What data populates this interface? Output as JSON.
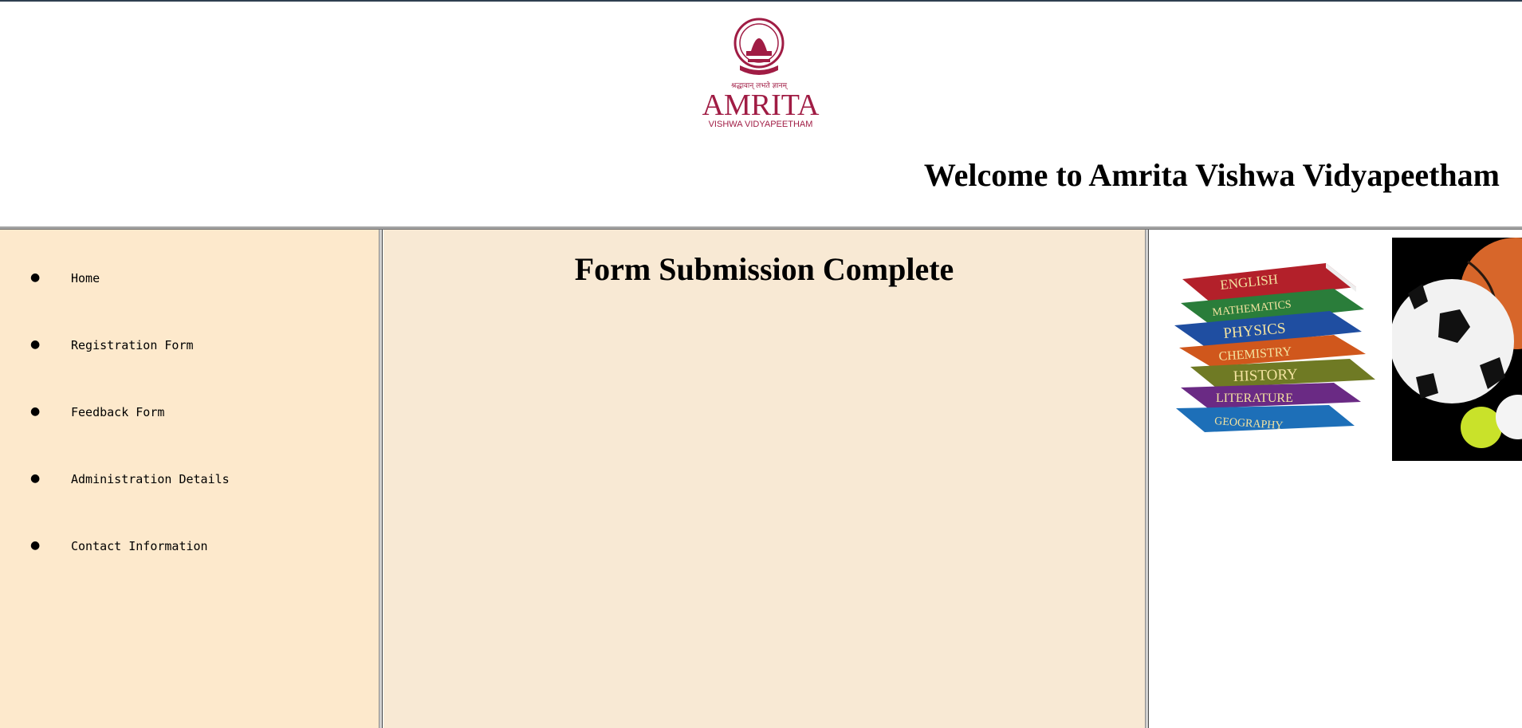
{
  "header": {
    "logo": {
      "name": "AMRITA",
      "subname": "VISHWA VIDYAPEETHAM",
      "motto": "श्रद्धावान् लभते ज्ञानम्",
      "color": "#a01c44"
    },
    "welcome_text": "Welcome to Amrita Vishwa Vidyapeetham"
  },
  "sidebar": {
    "background": "#fde9cc",
    "items": [
      {
        "label": "Home"
      },
      {
        "label": "Registration Form"
      },
      {
        "label": "Feedback Form"
      },
      {
        "label": "Administration Details"
      },
      {
        "label": "Contact Information"
      }
    ]
  },
  "main": {
    "background": "#f8e9d4",
    "title": "Form Submission Complete"
  },
  "right_panel": {
    "books_image": {
      "icon": "books-stack-image",
      "subjects": [
        "ENGLISH",
        "MATHEMATICS",
        "PHYSICS",
        "CHEMISTRY",
        "HISTORY",
        "LITERATURE",
        "GEOGRAPHY"
      ],
      "colors": [
        "#b3202a",
        "#2a7d3a",
        "#1f4ea1",
        "#d0571c",
        "#6f7a24",
        "#6a2a84",
        "#1d6fb8"
      ]
    },
    "sports_image": {
      "icon": "sports-balls-image"
    }
  }
}
